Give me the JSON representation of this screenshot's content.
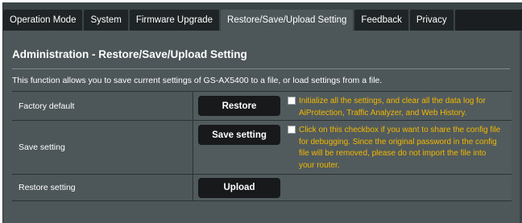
{
  "tabs": [
    {
      "label": "Operation Mode"
    },
    {
      "label": "System"
    },
    {
      "label": "Firmware Upgrade"
    },
    {
      "label": "Restore/Save/Upload Setting"
    },
    {
      "label": "Feedback"
    },
    {
      "label": "Privacy"
    }
  ],
  "active_tab": "Restore/Save/Upload Setting",
  "page": {
    "title": "Administration - Restore/Save/Upload Setting",
    "description": "This function allows you to save current settings of GS-AX5400 to a file, or load settings from a file."
  },
  "rows": {
    "factory_default": {
      "label": "Factory default",
      "button": "Restore",
      "checkbox_checked": false,
      "option_text": "Initialize all the settings, and clear all the data log for AiProtection, Traffic Analyzer, and Web History."
    },
    "save_setting": {
      "label": "Save setting",
      "button": "Save setting",
      "checkbox_checked": false,
      "option_text": "Click on this checkbox if you want to share the config file for debugging. Since the original password in the config file will be removed, please do not import the file into your router."
    },
    "restore_setting": {
      "label": "Restore setting",
      "button": "Upload"
    }
  },
  "colors": {
    "background": "#4d5659",
    "button": "#17191a",
    "option_text": "#f5b800"
  }
}
